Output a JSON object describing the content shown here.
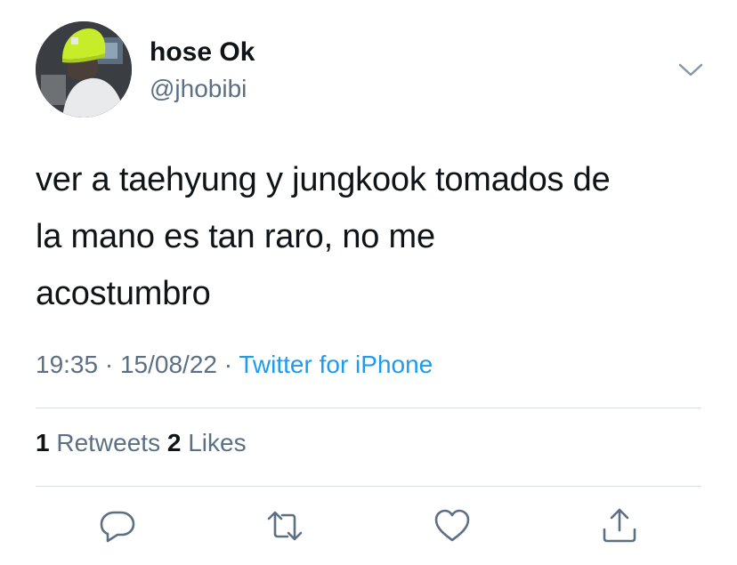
{
  "user": {
    "display_name": "hose Ok",
    "handle": "@jhobibi"
  },
  "tweet": {
    "lines": [
      "ver a taehyung y jungkook tomados de",
      "la mano es tan raro, no me",
      "acostumbro"
    ],
    "time": "19:35",
    "date": "15/08/22",
    "separator": " · ",
    "source": "Twitter for iPhone"
  },
  "stats": {
    "retweets_count": "1",
    "retweets_label": "Retweets",
    "likes_count": "2",
    "likes_label": "Likes"
  },
  "icons": {
    "menu": "chevron-down-icon",
    "reply": "reply-icon",
    "retweet": "retweet-icon",
    "like": "heart-icon",
    "share": "share-icon"
  },
  "colors": {
    "text": "#0f1419",
    "secondary": "#5b7083",
    "link": "#1d9bf0",
    "divider": "#dbe0e4",
    "beanie": "#c6ec2a"
  }
}
